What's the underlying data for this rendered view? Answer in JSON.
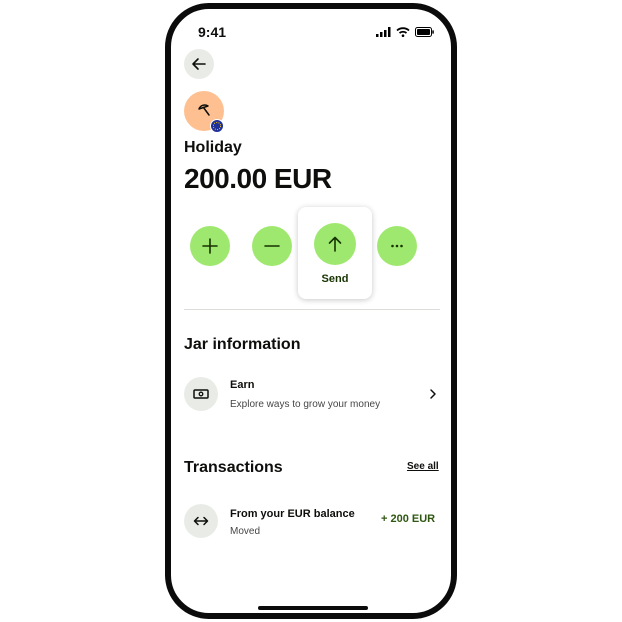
{
  "status_bar": {
    "time": "9:41"
  },
  "jar": {
    "name": "Holiday",
    "balance": "200.00 EUR"
  },
  "actions": {
    "send_label": "Send"
  },
  "jar_information": {
    "title": "Jar information",
    "earn": {
      "title": "Earn",
      "subtitle": "Explore ways to grow your money"
    }
  },
  "transactions": {
    "title": "Transactions",
    "see_all": "See all",
    "items": [
      {
        "title": "From your EUR balance",
        "subtitle": "Moved",
        "amount": "+ 200 EUR"
      }
    ]
  },
  "colors": {
    "accent": "#9fe870",
    "avatar_bg": "#ffc091",
    "amount_positive": "#2f5711",
    "icon_bg": "#e9ece6"
  }
}
